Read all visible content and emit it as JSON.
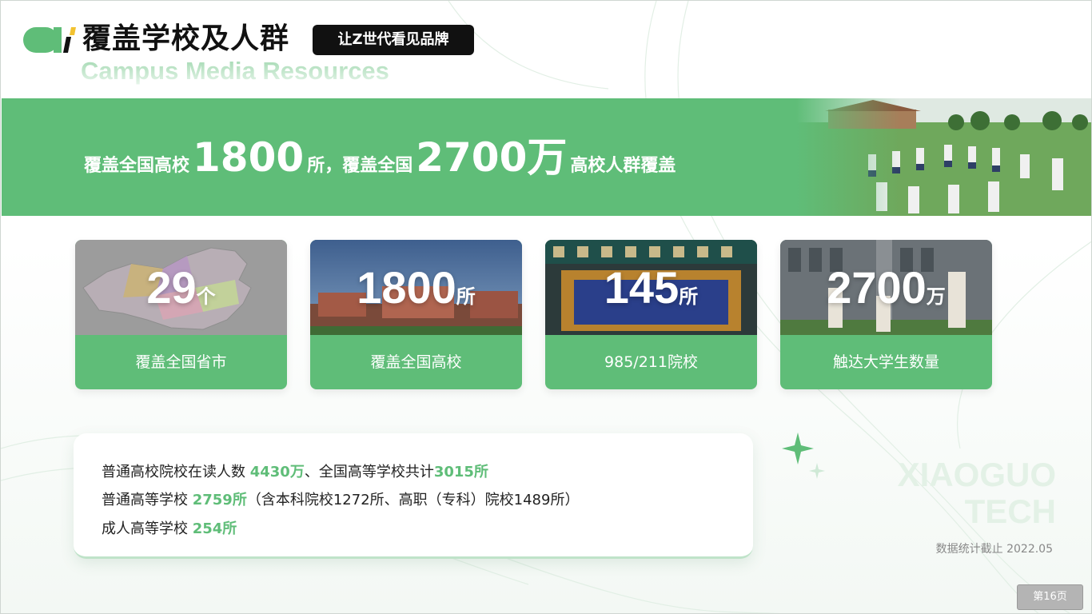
{
  "header": {
    "title": "覆盖学校及人群",
    "slogan": "让Z世代看见品牌",
    "subtitle": "Campus Media Resources",
    "logo_icon": "brand-logo-icon"
  },
  "banner": {
    "prefix": "覆盖全国高校",
    "num1": "1800",
    "mid": "所，覆盖全国",
    "num2": "2700万",
    "suffix": "高校人群覆盖"
  },
  "cards": [
    {
      "number": "29",
      "unit": "个",
      "label": "覆盖全国省市",
      "image": "china-map-image"
    },
    {
      "number": "1800",
      "unit": "所",
      "label": "覆盖全国高校",
      "image": "campus-buildings-image"
    },
    {
      "number": "145",
      "unit": "所",
      "label": "985/211院校",
      "image": "university-gate-image"
    },
    {
      "number": "2700",
      "unit": "万",
      "label": "触达大学生数量",
      "image": "students-image"
    }
  ],
  "info": {
    "line1_a": "普通高校院校在读人数 ",
    "line1_b": "4430万",
    "line1_c": "、全国高等学校共计",
    "line1_d": "3015所",
    "line2_a": "普通高等学校 ",
    "line2_b": "2759所",
    "line2_c": "（含本科院校1272所、高职（专科）院校1489所）",
    "line3_a": "成人高等学校 ",
    "line3_b": "254所"
  },
  "watermark": {
    "line1": "XIAOGUO",
    "line2": "TECH"
  },
  "footnote": "数据统计截止 2022.05",
  "page_button": "第16页",
  "colors": {
    "accent": "#5fbd78",
    "dark": "#111111"
  }
}
